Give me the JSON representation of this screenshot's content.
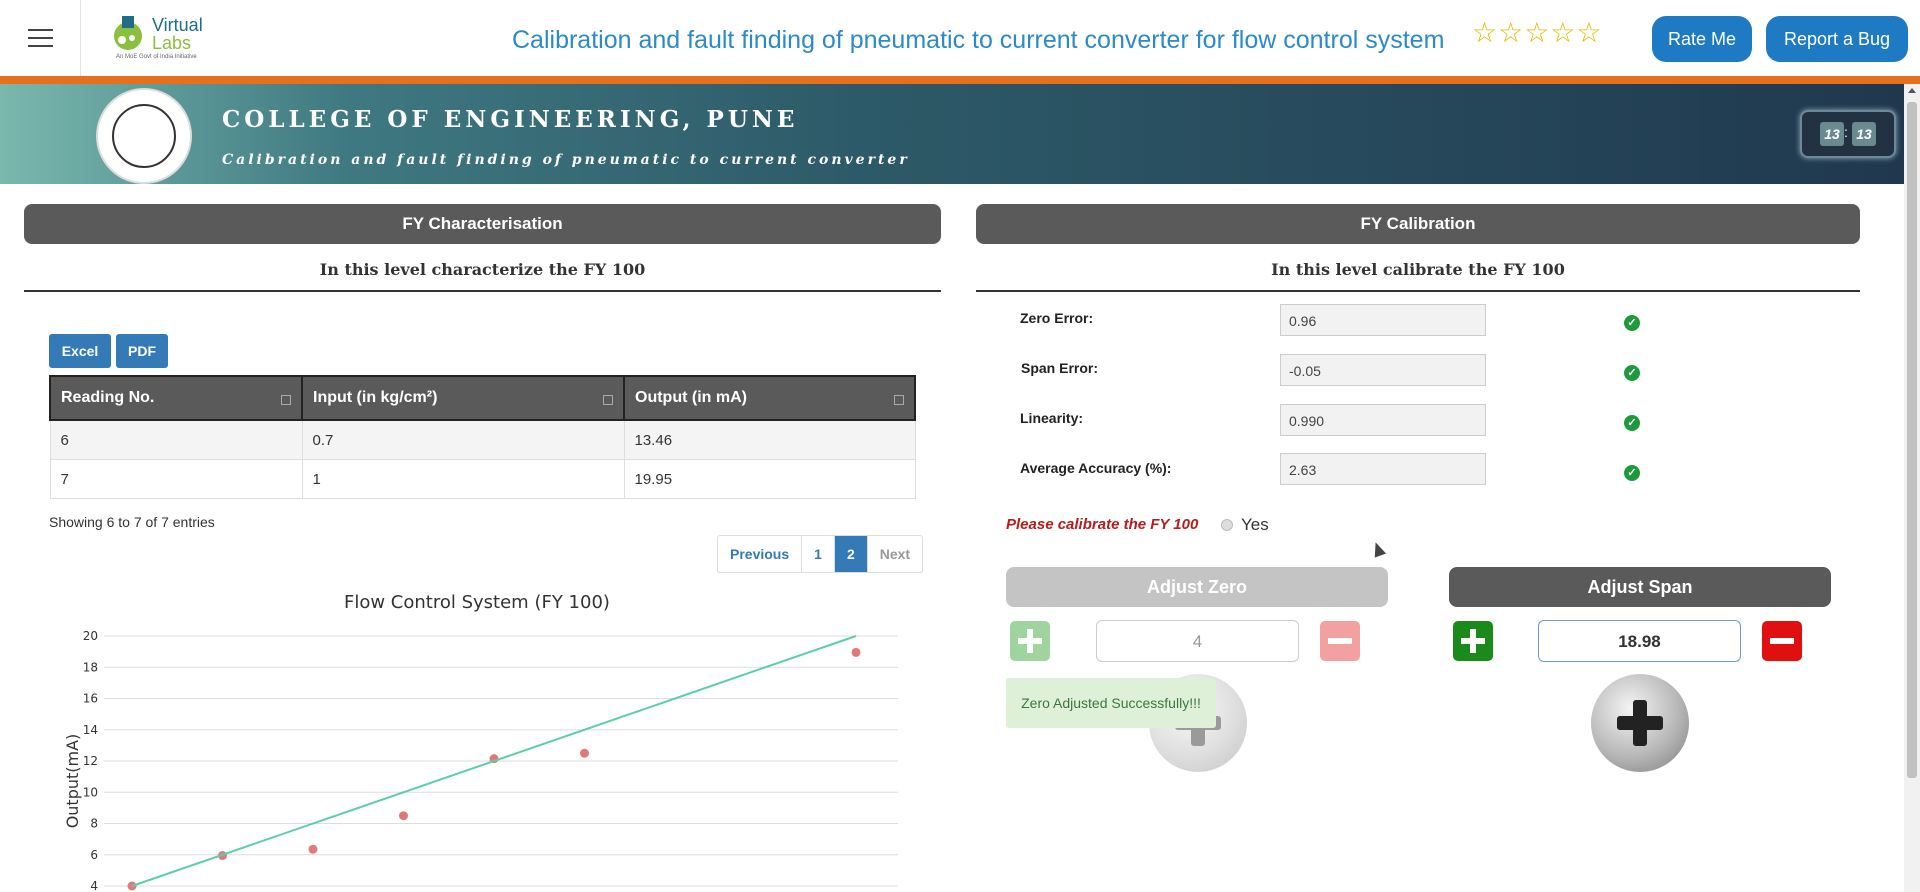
{
  "nav": {
    "menu_icon": "hamburger-icon",
    "logo_line1": "Virtual",
    "logo_line2": "Labs",
    "logo_tagline": "An MoE Govt of India Initiative",
    "title": "Calibration and fault finding of pneumatic to current converter for flow control system",
    "stars": "☆☆☆☆☆",
    "rate_label": "Rate Me",
    "bug_label": "Report a Bug"
  },
  "banner": {
    "college": "COLLEGE OF ENGINEERING, PUNE",
    "subtitle": "Calibration and fault finding of pneumatic to current converter",
    "timer_min": "13",
    "timer_sec": "13"
  },
  "left": {
    "header": "FY Characterisation",
    "subheader": "In this level characterize the FY 100",
    "excel_label": "Excel",
    "pdf_label": "PDF",
    "table": {
      "columns": [
        "Reading No.",
        "Input (in kg/cm²)",
        "Output (in mA)"
      ],
      "rows": [
        [
          "6",
          "0.7",
          "13.46"
        ],
        [
          "7",
          "1",
          "19.95"
        ]
      ]
    },
    "info": "Showing 6 to 7 of 7 entries",
    "pager": {
      "prev": "Previous",
      "p1": "1",
      "p2": "2",
      "next": "Next"
    }
  },
  "right": {
    "header": "FY Calibration",
    "subheader": "In this level calibrate the FY 100",
    "fields": [
      {
        "label": "Zero Error:",
        "value": "0.96"
      },
      {
        "label": "Span Error:",
        "value": "-0.05"
      },
      {
        "label": "Linearity:",
        "value": "0.990"
      },
      {
        "label": "Average Accuracy (%):",
        "value": "2.63"
      }
    ],
    "prompt": "Please calibrate the FY 100",
    "yes_label": "Yes",
    "adjust_zero": "Adjust Zero",
    "adjust_span": "Adjust Span",
    "zero_value": "4",
    "span_value": "18.98",
    "toast": "Zero Adjusted Successfully!!!"
  },
  "chart_data": {
    "type": "scatter",
    "title": "Flow Control System (FY 100)",
    "xlabel": "",
    "ylabel": "Output(mA)",
    "ylim": [
      4,
      20
    ],
    "yticks": [
      4,
      6,
      8,
      10,
      12,
      14,
      16,
      18,
      20
    ],
    "grid": true,
    "series": [
      {
        "kind": "points",
        "color": "#e07a7a",
        "x": [
          0,
          0.1,
          0.2,
          0.3,
          0.4,
          0.5,
          0.8
        ],
        "y": [
          4,
          5.95,
          6.35,
          8.5,
          12.15,
          12.5,
          18.95
        ]
      },
      {
        "kind": "line",
        "color": "#5ccfa8",
        "x": [
          0,
          0.8
        ],
        "y": [
          4,
          20
        ]
      }
    ],
    "xlim": [
      0,
      0.8
    ]
  }
}
